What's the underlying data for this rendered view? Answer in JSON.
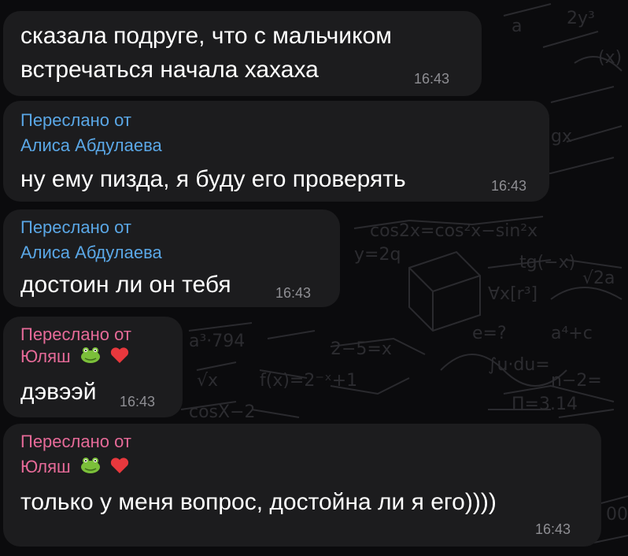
{
  "chat": {
    "messages": [
      {
        "text_line1": "сказала подруге, что с мальчиком",
        "text_line2": "встречаться начала хахаха",
        "time": "16:43"
      },
      {
        "forwarded_label": "Переслано от",
        "forwarded_from": "Алиса Абдулаева",
        "text": "ну ему пизда, я буду его проверять",
        "time": "16:43"
      },
      {
        "forwarded_label": "Переслано от",
        "forwarded_from": "Алиса Абдулаева",
        "text": "достоин ли он тебя",
        "time": "16:43"
      },
      {
        "forwarded_label": "Переслано от",
        "forwarded_from": "Юляш",
        "text": "дэвээй",
        "time": "16:43"
      },
      {
        "forwarded_label": "Переслано от",
        "forwarded_from": "Юляш",
        "text": "только у меня вопрос, достойна ли я его))))",
        "time": "16:43"
      }
    ]
  },
  "colors": {
    "bubble": "#1c1c1e",
    "sender_blue": "#5aa7e6",
    "sender_pink": "#e66a98",
    "timestamp": "#8e8e93"
  },
  "icons": [
    "frog-emoji-icon",
    "red-heart-emoji-icon"
  ]
}
